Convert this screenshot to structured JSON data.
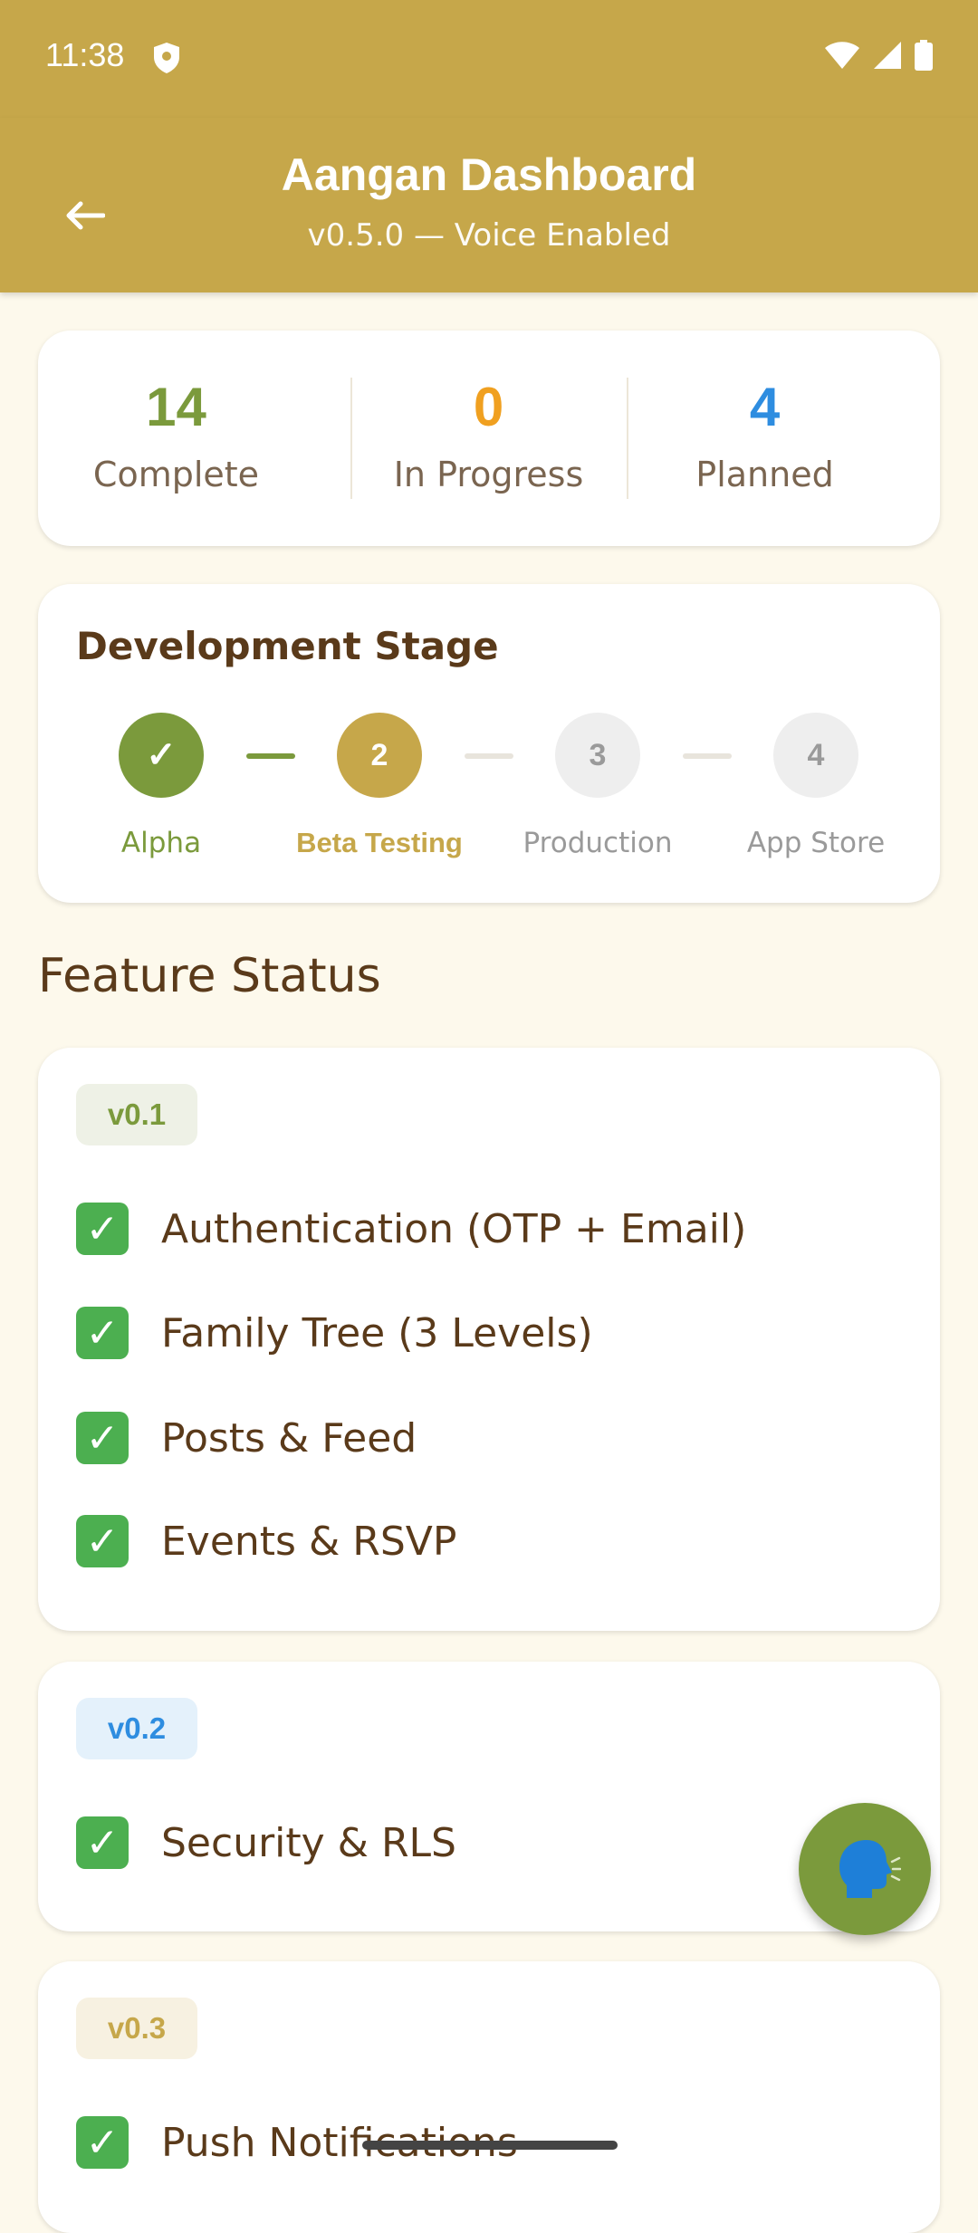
{
  "status_bar": {
    "time": "11:38"
  },
  "header": {
    "title": "Aangan Dashboard",
    "subtitle": "v0.5.0 — Voice Enabled"
  },
  "stats": [
    {
      "value": "14",
      "label": "Complete",
      "color": "#7b9a3c"
    },
    {
      "value": "0",
      "label": "In Progress",
      "color": "#f0a020"
    },
    {
      "value": "4",
      "label": "Planned",
      "color": "#2e8de0"
    }
  ],
  "stage": {
    "title": "Development Stage",
    "steps": [
      {
        "marker": "✓",
        "label": "Alpha",
        "state": "done"
      },
      {
        "marker": "2",
        "label": "Beta Testing",
        "state": "current"
      },
      {
        "marker": "3",
        "label": "Production",
        "state": "pending"
      },
      {
        "marker": "4",
        "label": "App Store",
        "state": "pending"
      }
    ]
  },
  "features_title": "Feature Status",
  "feature_groups": [
    {
      "version": "v0.1",
      "items": [
        "Authentication (OTP + Email)",
        "Family Tree (3 Levels)",
        "Posts & Feed",
        "Events & RSVP"
      ]
    },
    {
      "version": "v0.2",
      "items": [
        "Security & RLS"
      ]
    },
    {
      "version": "v0.3",
      "items": [
        "Push Notifications"
      ]
    }
  ],
  "colors": {
    "header": "#c6a74a",
    "done": "#7b9a3c",
    "current": "#c6a74a",
    "pending": "#eeeeee",
    "background": "#fdf9ec"
  }
}
